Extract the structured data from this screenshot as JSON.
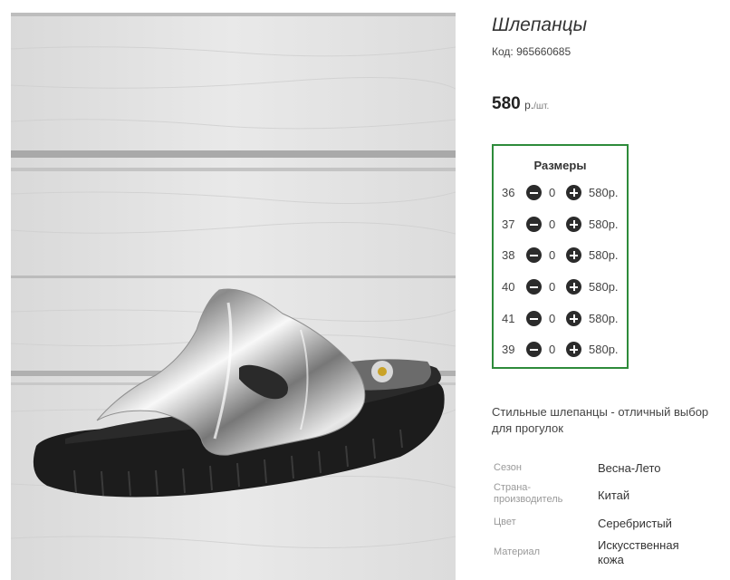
{
  "product": {
    "title": "Шлепанцы",
    "code_label": "Код:",
    "code": "965660685",
    "price": "580",
    "price_unit": "р.",
    "price_per": "/шт."
  },
  "sizes": {
    "title": "Размеры",
    "rows": [
      {
        "size": "36",
        "qty": "0",
        "price": "580р."
      },
      {
        "size": "37",
        "qty": "0",
        "price": "580р."
      },
      {
        "size": "38",
        "qty": "0",
        "price": "580р."
      },
      {
        "size": "40",
        "qty": "0",
        "price": "580р."
      },
      {
        "size": "41",
        "qty": "0",
        "price": "580р."
      },
      {
        "size": "39",
        "qty": "0",
        "price": "580р."
      }
    ]
  },
  "description": "Стильные шлепанцы - отличный выбор для прогулок",
  "attributes": [
    {
      "label": "Сезон",
      "value": "Весна-Лето"
    },
    {
      "label": "Страна-производитель",
      "value": "Китай"
    },
    {
      "label": "Цвет",
      "value": "Серебристый"
    },
    {
      "label": "Материал",
      "value": "Искусственная кожа"
    }
  ],
  "colors": {
    "sizes_border": "#2e8b3a",
    "button": "#2b2b2b"
  }
}
